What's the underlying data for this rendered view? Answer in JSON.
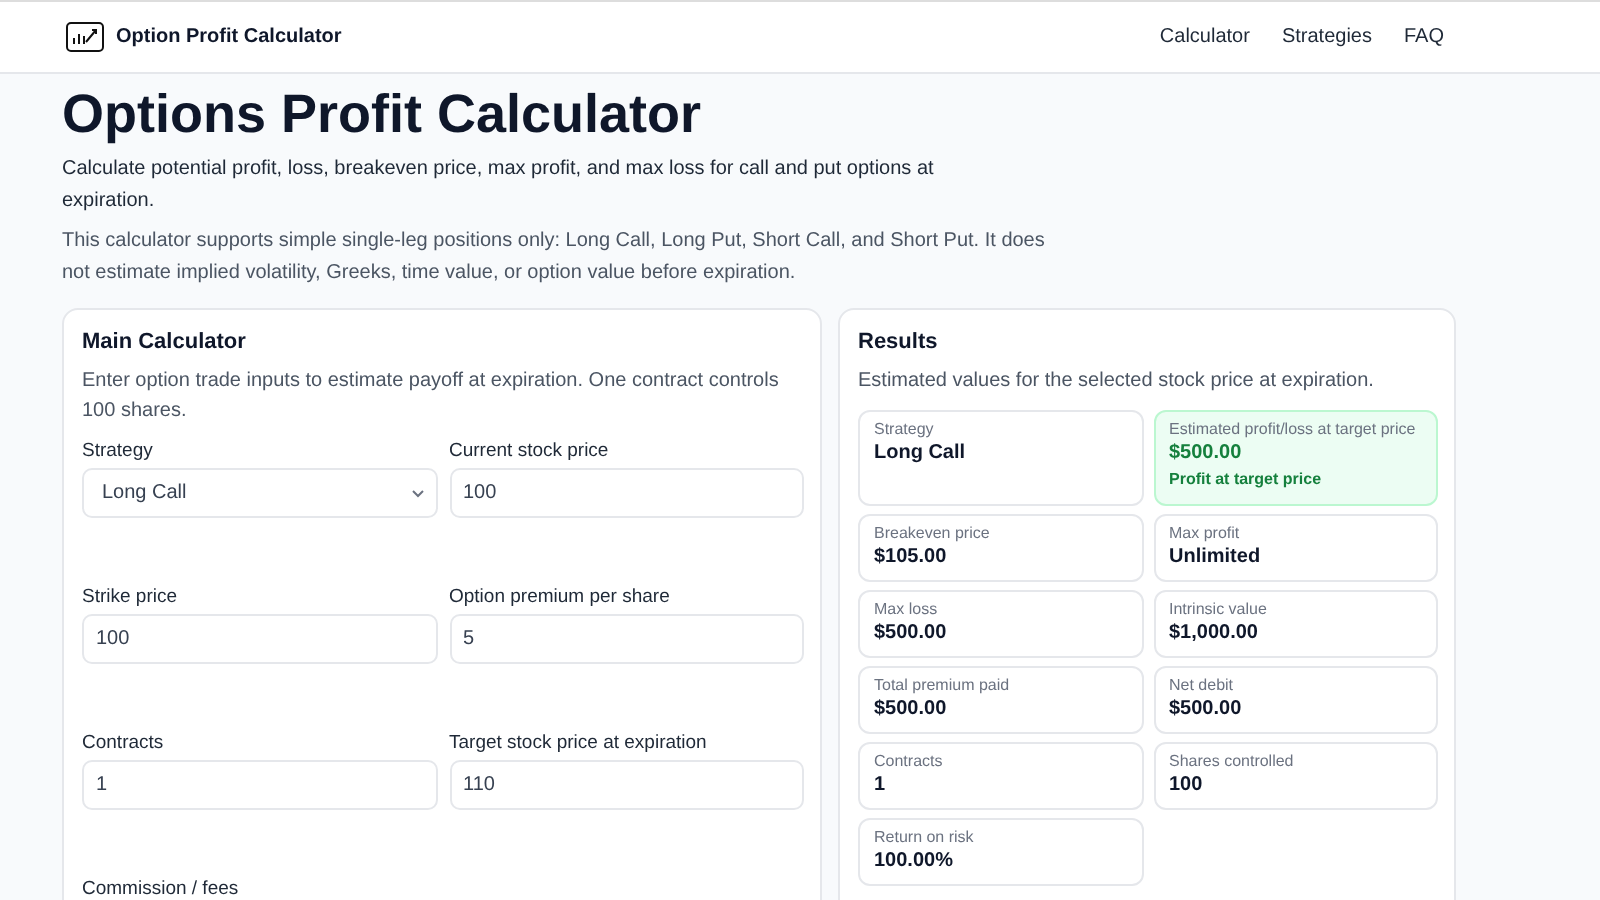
{
  "header": {
    "brand": "Option Profit Calculator",
    "nav": [
      {
        "label": "Calculator"
      },
      {
        "label": "Strategies"
      },
      {
        "label": "FAQ"
      }
    ]
  },
  "page": {
    "title": "Options Profit Calculator",
    "intro": "Calculate potential profit, loss, breakeven price, max profit, and max loss for call and put options at expiration.",
    "note": "This calculator supports simple single-leg positions only: Long Call, Long Put, Short Call, and Short Put. It does not estimate implied volatility, Greeks, time value, or option value before expiration."
  },
  "calculator": {
    "title": "Main Calculator",
    "description": "Enter option trade inputs to estimate payoff at expiration. One contract controls 100 shares.",
    "fields": [
      {
        "label": "Strategy",
        "kind": "select",
        "value": "Long Call"
      },
      {
        "label": "Current stock price",
        "kind": "input",
        "value": "100"
      },
      {
        "label": "Strike price",
        "kind": "input",
        "value": "100"
      },
      {
        "label": "Option premium per share",
        "kind": "input",
        "value": "5"
      },
      {
        "label": "Contracts",
        "kind": "input",
        "value": "1"
      },
      {
        "label": "Target stock price at expiration",
        "kind": "input",
        "value": "110"
      },
      {
        "label": "Commission / fees",
        "kind": "label"
      }
    ]
  },
  "results": {
    "title": "Results",
    "description": "Estimated values for the selected stock price at expiration.",
    "cards": [
      {
        "label": "Strategy",
        "value": "Long Call",
        "kind": "plain"
      },
      {
        "label": "Estimated profit/loss at target price",
        "value": "$500.00",
        "note": "Profit at target price",
        "kind": "profit"
      },
      {
        "label": "Breakeven price",
        "value": "$105.00",
        "kind": "plain"
      },
      {
        "label": "Max profit",
        "value": "Unlimited",
        "kind": "plain"
      },
      {
        "label": "Max loss",
        "value": "$500.00",
        "kind": "plain"
      },
      {
        "label": "Intrinsic value",
        "value": "$1,000.00",
        "kind": "plain"
      },
      {
        "label": "Total premium paid",
        "value": "$500.00",
        "kind": "plain"
      },
      {
        "label": "Net debit",
        "value": "$500.00",
        "kind": "plain"
      },
      {
        "label": "Contracts",
        "value": "1",
        "kind": "plain"
      },
      {
        "label": "Shares controlled",
        "value": "100",
        "kind": "plain"
      },
      {
        "label": "Return on risk",
        "value": "100.00%",
        "kind": "plain"
      }
    ]
  }
}
